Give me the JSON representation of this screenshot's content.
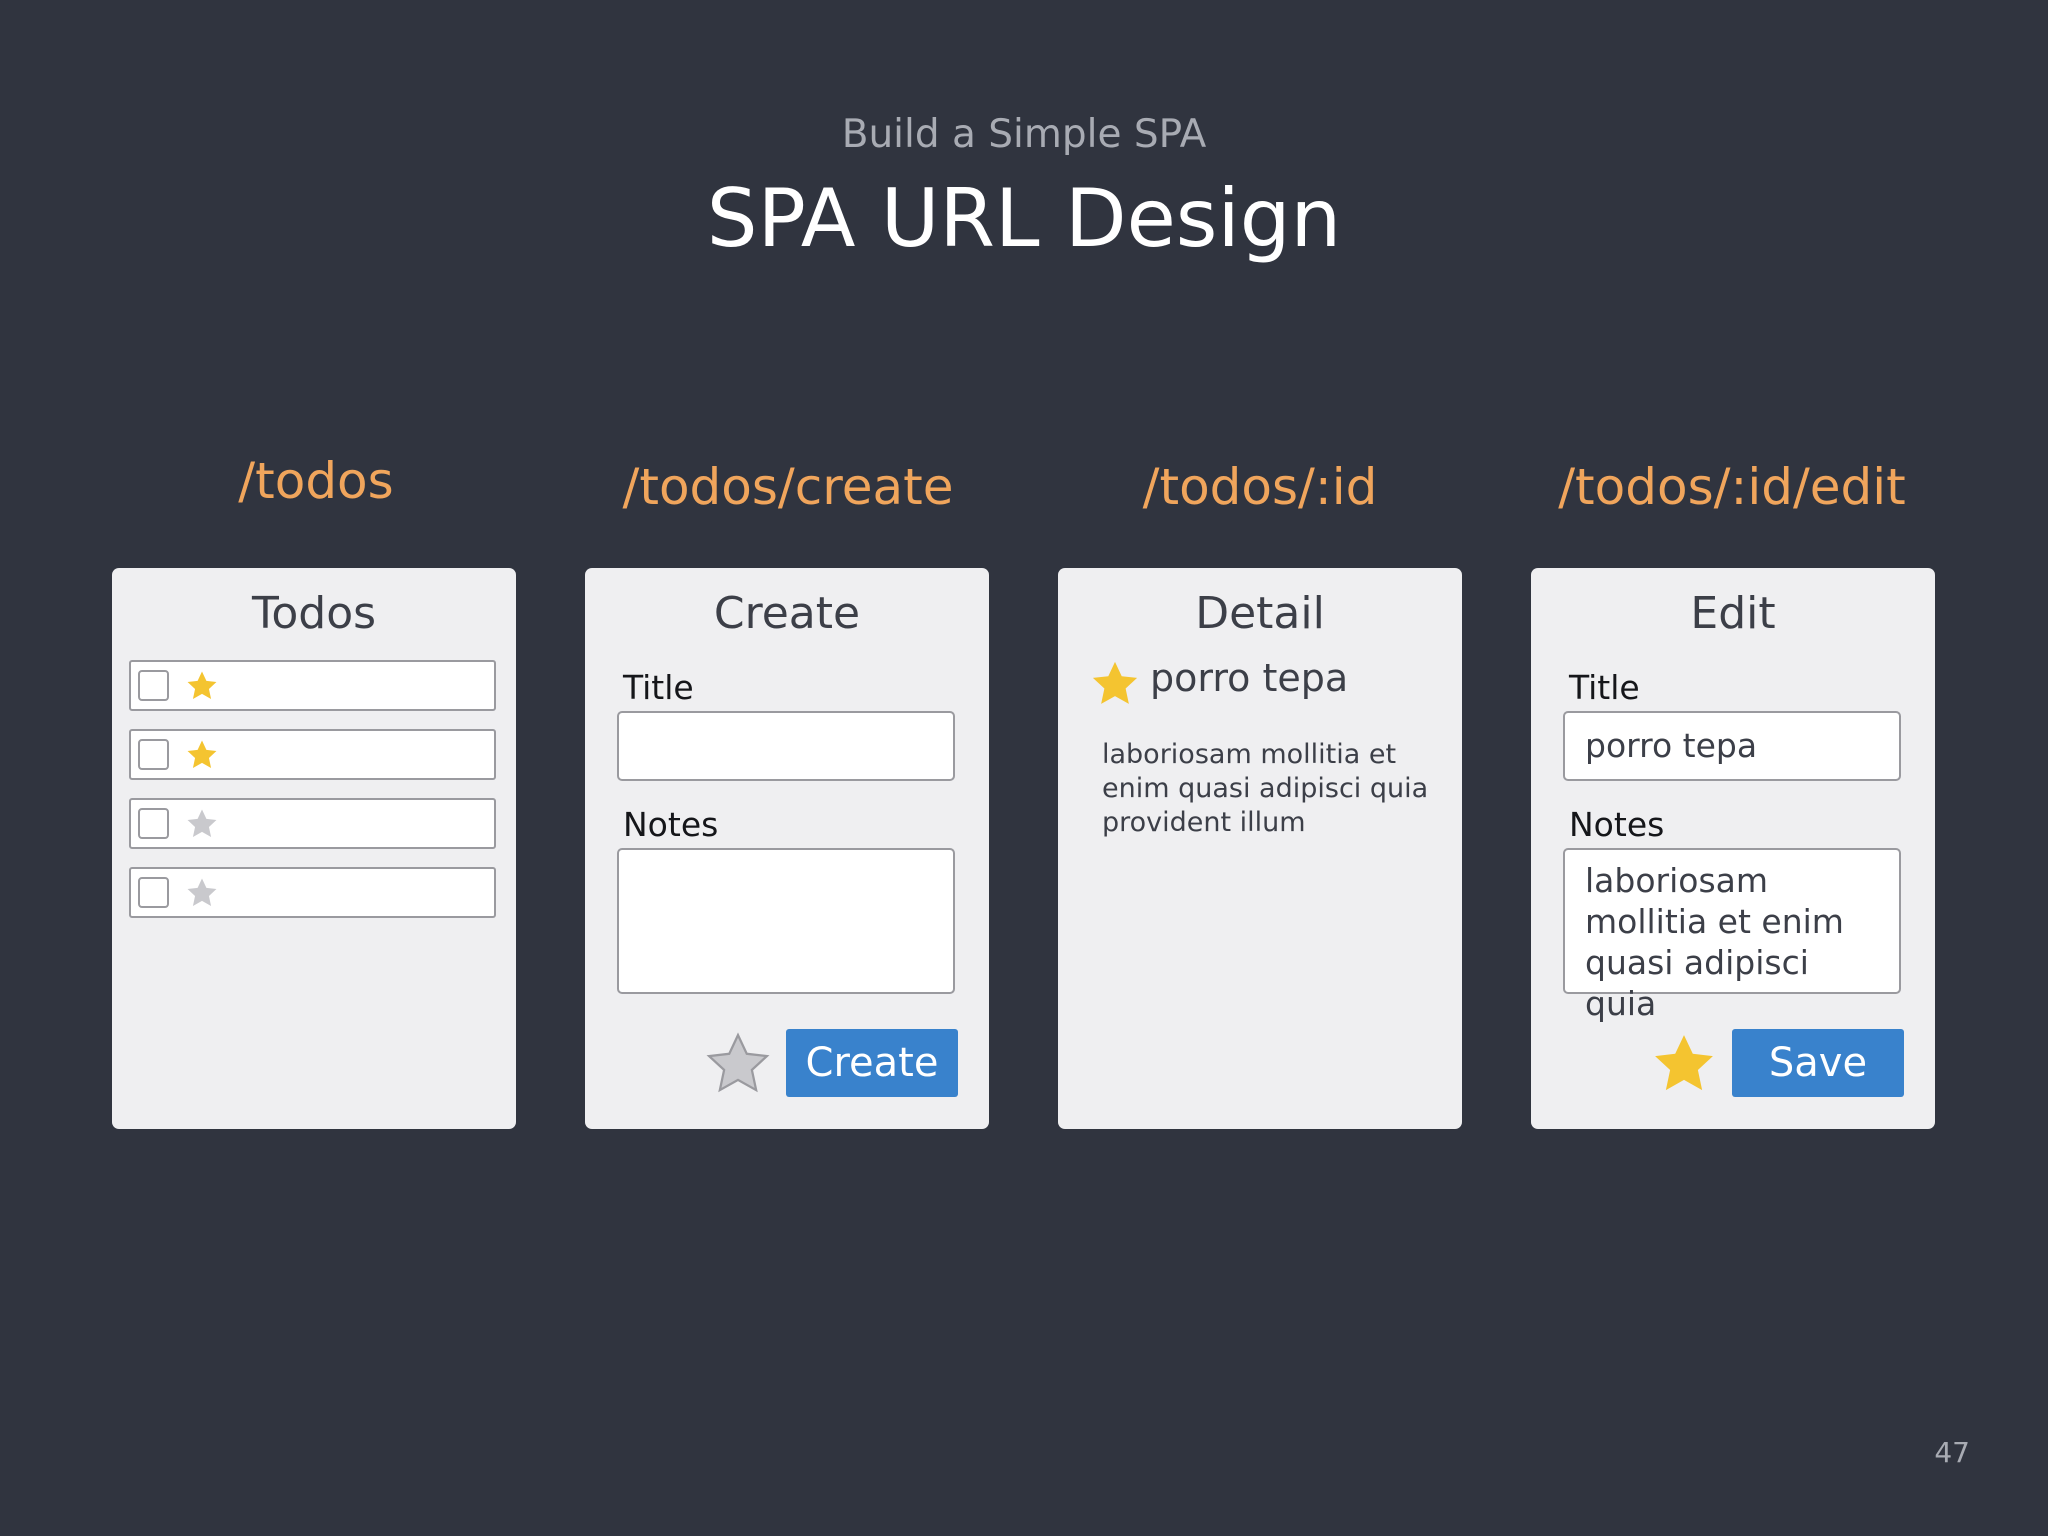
{
  "slide": {
    "subtitle": "Build a Simple SPA",
    "title": "SPA URL Design",
    "page_number": "47"
  },
  "colors": {
    "background": "#30343f",
    "route": "#f0a55c",
    "card": "#efeff1",
    "button": "#3982cc",
    "star_on": "#f4c430",
    "star_off": "#c9c9cd"
  },
  "routes": [
    "/todos",
    "/todos/create",
    "/todos/:id",
    "/todos/:id/edit"
  ],
  "todos_card": {
    "title": "Todos",
    "rows": [
      {
        "checked": false,
        "starred": true
      },
      {
        "checked": false,
        "starred": true
      },
      {
        "checked": false,
        "starred": false
      },
      {
        "checked": false,
        "starred": false
      }
    ]
  },
  "create_card": {
    "title": "Create",
    "title_label": "Title",
    "title_value": "",
    "notes_label": "Notes",
    "notes_value": "",
    "starred": false,
    "button_label": "Create"
  },
  "detail_card": {
    "title": "Detail",
    "starred": true,
    "todo_title": "porro tepa",
    "notes": "laboriosam mollitia et enim quasi adipisci quia provident illum"
  },
  "edit_card": {
    "title": "Edit",
    "title_label": "Title",
    "title_value": "porro tepa",
    "notes_label": "Notes",
    "notes_value": "laboriosam mollitia et enim quasi adipisci quia",
    "starred": true,
    "button_label": "Save"
  }
}
